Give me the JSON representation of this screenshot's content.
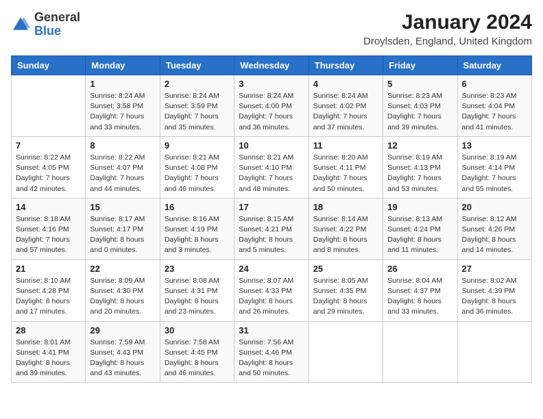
{
  "header": {
    "logo_general": "General",
    "logo_blue": "Blue",
    "calendar_title": "January 2024",
    "calendar_subtitle": "Droylsden, England, United Kingdom"
  },
  "days_of_week": [
    "Sunday",
    "Monday",
    "Tuesday",
    "Wednesday",
    "Thursday",
    "Friday",
    "Saturday"
  ],
  "weeks": [
    [
      {
        "day": "",
        "sunrise": "",
        "sunset": "",
        "daylight": ""
      },
      {
        "day": "1",
        "sunrise": "Sunrise: 8:24 AM",
        "sunset": "Sunset: 3:58 PM",
        "daylight": "Daylight: 7 hours and 33 minutes."
      },
      {
        "day": "2",
        "sunrise": "Sunrise: 8:24 AM",
        "sunset": "Sunset: 3:59 PM",
        "daylight": "Daylight: 7 hours and 35 minutes."
      },
      {
        "day": "3",
        "sunrise": "Sunrise: 8:24 AM",
        "sunset": "Sunset: 4:00 PM",
        "daylight": "Daylight: 7 hours and 36 minutes."
      },
      {
        "day": "4",
        "sunrise": "Sunrise: 8:24 AM",
        "sunset": "Sunset: 4:02 PM",
        "daylight": "Daylight: 7 hours and 37 minutes."
      },
      {
        "day": "5",
        "sunrise": "Sunrise: 8:23 AM",
        "sunset": "Sunset: 4:03 PM",
        "daylight": "Daylight: 7 hours and 39 minutes."
      },
      {
        "day": "6",
        "sunrise": "Sunrise: 8:23 AM",
        "sunset": "Sunset: 4:04 PM",
        "daylight": "Daylight: 7 hours and 41 minutes."
      }
    ],
    [
      {
        "day": "7",
        "sunrise": "Sunrise: 8:22 AM",
        "sunset": "Sunset: 4:05 PM",
        "daylight": "Daylight: 7 hours and 42 minutes."
      },
      {
        "day": "8",
        "sunrise": "Sunrise: 8:22 AM",
        "sunset": "Sunset: 4:07 PM",
        "daylight": "Daylight: 7 hours and 44 minutes."
      },
      {
        "day": "9",
        "sunrise": "Sunrise: 8:21 AM",
        "sunset": "Sunset: 4:08 PM",
        "daylight": "Daylight: 7 hours and 46 minutes."
      },
      {
        "day": "10",
        "sunrise": "Sunrise: 8:21 AM",
        "sunset": "Sunset: 4:10 PM",
        "daylight": "Daylight: 7 hours and 48 minutes."
      },
      {
        "day": "11",
        "sunrise": "Sunrise: 8:20 AM",
        "sunset": "Sunset: 4:11 PM",
        "daylight": "Daylight: 7 hours and 50 minutes."
      },
      {
        "day": "12",
        "sunrise": "Sunrise: 8:19 AM",
        "sunset": "Sunset: 4:13 PM",
        "daylight": "Daylight: 7 hours and 53 minutes."
      },
      {
        "day": "13",
        "sunrise": "Sunrise: 8:19 AM",
        "sunset": "Sunset: 4:14 PM",
        "daylight": "Daylight: 7 hours and 55 minutes."
      }
    ],
    [
      {
        "day": "14",
        "sunrise": "Sunrise: 8:18 AM",
        "sunset": "Sunset: 4:16 PM",
        "daylight": "Daylight: 7 hours and 57 minutes."
      },
      {
        "day": "15",
        "sunrise": "Sunrise: 8:17 AM",
        "sunset": "Sunset: 4:17 PM",
        "daylight": "Daylight: 8 hours and 0 minutes."
      },
      {
        "day": "16",
        "sunrise": "Sunrise: 8:16 AM",
        "sunset": "Sunset: 4:19 PM",
        "daylight": "Daylight: 8 hours and 3 minutes."
      },
      {
        "day": "17",
        "sunrise": "Sunrise: 8:15 AM",
        "sunset": "Sunset: 4:21 PM",
        "daylight": "Daylight: 8 hours and 5 minutes."
      },
      {
        "day": "18",
        "sunrise": "Sunrise: 8:14 AM",
        "sunset": "Sunset: 4:22 PM",
        "daylight": "Daylight: 8 hours and 8 minutes."
      },
      {
        "day": "19",
        "sunrise": "Sunrise: 8:13 AM",
        "sunset": "Sunset: 4:24 PM",
        "daylight": "Daylight: 8 hours and 11 minutes."
      },
      {
        "day": "20",
        "sunrise": "Sunrise: 8:12 AM",
        "sunset": "Sunset: 4:26 PM",
        "daylight": "Daylight: 8 hours and 14 minutes."
      }
    ],
    [
      {
        "day": "21",
        "sunrise": "Sunrise: 8:10 AM",
        "sunset": "Sunset: 4:28 PM",
        "daylight": "Daylight: 8 hours and 17 minutes."
      },
      {
        "day": "22",
        "sunrise": "Sunrise: 8:09 AM",
        "sunset": "Sunset: 4:30 PM",
        "daylight": "Daylight: 8 hours and 20 minutes."
      },
      {
        "day": "23",
        "sunrise": "Sunrise: 8:08 AM",
        "sunset": "Sunset: 4:31 PM",
        "daylight": "Daylight: 8 hours and 23 minutes."
      },
      {
        "day": "24",
        "sunrise": "Sunrise: 8:07 AM",
        "sunset": "Sunset: 4:33 PM",
        "daylight": "Daylight: 8 hours and 26 minutes."
      },
      {
        "day": "25",
        "sunrise": "Sunrise: 8:05 AM",
        "sunset": "Sunset: 4:35 PM",
        "daylight": "Daylight: 8 hours and 29 minutes."
      },
      {
        "day": "26",
        "sunrise": "Sunrise: 8:04 AM",
        "sunset": "Sunset: 4:37 PM",
        "daylight": "Daylight: 8 hours and 33 minutes."
      },
      {
        "day": "27",
        "sunrise": "Sunrise: 8:02 AM",
        "sunset": "Sunset: 4:39 PM",
        "daylight": "Daylight: 8 hours and 36 minutes."
      }
    ],
    [
      {
        "day": "28",
        "sunrise": "Sunrise: 8:01 AM",
        "sunset": "Sunset: 4:41 PM",
        "daylight": "Daylight: 8 hours and 39 minutes."
      },
      {
        "day": "29",
        "sunrise": "Sunrise: 7:59 AM",
        "sunset": "Sunset: 4:43 PM",
        "daylight": "Daylight: 8 hours and 43 minutes."
      },
      {
        "day": "30",
        "sunrise": "Sunrise: 7:58 AM",
        "sunset": "Sunset: 4:45 PM",
        "daylight": "Daylight: 8 hours and 46 minutes."
      },
      {
        "day": "31",
        "sunrise": "Sunrise: 7:56 AM",
        "sunset": "Sunset: 4:46 PM",
        "daylight": "Daylight: 8 hours and 50 minutes."
      },
      {
        "day": "",
        "sunrise": "",
        "sunset": "",
        "daylight": ""
      },
      {
        "day": "",
        "sunrise": "",
        "sunset": "",
        "daylight": ""
      },
      {
        "day": "",
        "sunrise": "",
        "sunset": "",
        "daylight": ""
      }
    ]
  ]
}
